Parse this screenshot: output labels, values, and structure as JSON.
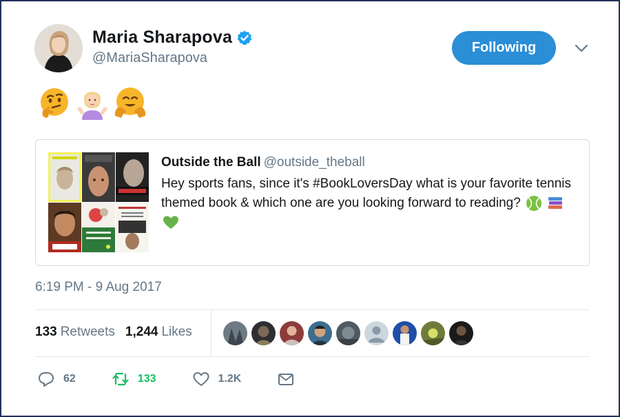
{
  "author": {
    "name": "Maria Sharapova",
    "handle": "@MariaSharapova",
    "verified": true
  },
  "follow_button": {
    "label": "Following",
    "color": "#2b8ed6"
  },
  "tweet_emojis": [
    "thinking-face",
    "person-shrugging",
    "hugging-face"
  ],
  "quoted_tweet": {
    "name": "Outside the Ball",
    "handle": "@outside_theball",
    "text": "Hey sports fans, since it's #BookLoversDay what is your favorite tennis themed book & which one are you looking forward to reading?",
    "emojis": [
      "tennis-ball",
      "books",
      "green-heart"
    ],
    "book_covers": [
      "UNSTOPPABLE",
      "OPEN",
      "MURRAY",
      "RAFA",
      "STRING THEORY",
      "Ways of Grace"
    ]
  },
  "timestamp": "6:19 PM - 9 Aug 2017",
  "stats": {
    "retweets_count": "133",
    "retweets_label": "Retweets",
    "likes_count": "1,244",
    "likes_label": "Likes"
  },
  "likers": [
    "liker-1",
    "liker-2",
    "liker-3",
    "liker-4",
    "liker-5",
    "liker-6",
    "liker-7",
    "liker-8",
    "liker-9"
  ],
  "actions": {
    "reply_count": "62",
    "retweet_count": "133",
    "like_count": "1.2K"
  },
  "colors": {
    "text": "#14171a",
    "muted": "#657786",
    "retweet": "#17bf63",
    "verified": "#1da1f2",
    "border": "#e1e8ed"
  }
}
